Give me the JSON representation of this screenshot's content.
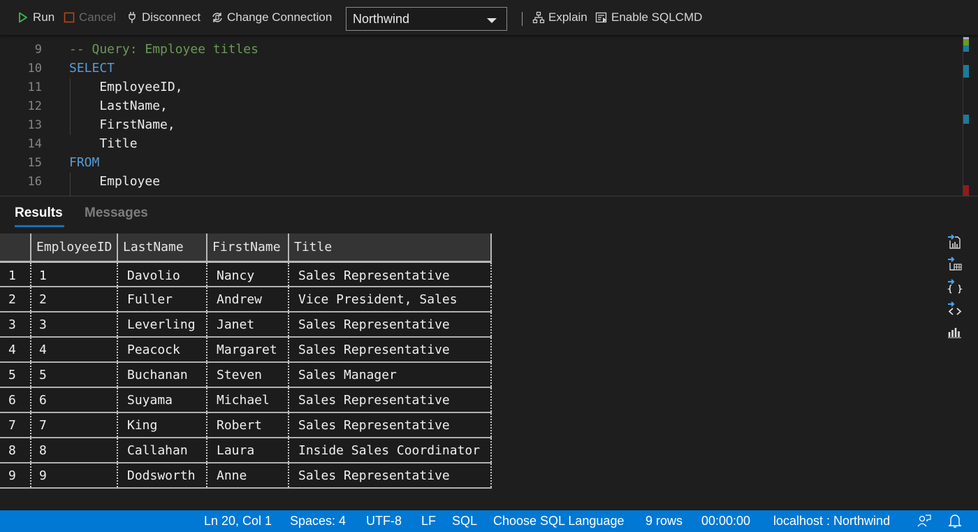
{
  "toolbar": {
    "run_label": "Run",
    "cancel_label": "Cancel",
    "disconnect_label": "Disconnect",
    "change_connection_label": "Change Connection",
    "database_selected": "Northwind",
    "explain_label": "Explain",
    "sqlcmd_label": "Enable SQLCMD",
    "colors": {
      "run_icon": "#3fb950",
      "cancel_icon": "#b5451b"
    }
  },
  "editor": {
    "lines": [
      {
        "num": "9",
        "text": "-- Query: Employee titles",
        "kind": "comment"
      },
      {
        "num": "10",
        "text": "SELECT",
        "kind": "keyword"
      },
      {
        "num": "11",
        "text": "    EmployeeID,",
        "kind": "plain"
      },
      {
        "num": "12",
        "text": "    LastName,",
        "kind": "plain"
      },
      {
        "num": "13",
        "text": "    FirstName,",
        "kind": "plain"
      },
      {
        "num": "14",
        "text": "    Title",
        "kind": "plain"
      },
      {
        "num": "15",
        "text": "FROM",
        "kind": "keyword"
      },
      {
        "num": "16",
        "text": "    Employee",
        "kind": "plain"
      }
    ]
  },
  "results": {
    "tabs": [
      {
        "label": "Results",
        "active": true
      },
      {
        "label": "Messages",
        "active": false
      }
    ],
    "columns": [
      "EmployeeID",
      "LastName",
      "FirstName",
      "Title"
    ],
    "rows": [
      {
        "n": "1",
        "cells": [
          "1",
          "Davolio",
          "Nancy",
          "Sales Representative"
        ]
      },
      {
        "n": "2",
        "cells": [
          "2",
          "Fuller",
          "Andrew",
          "Vice President, Sales"
        ]
      },
      {
        "n": "3",
        "cells": [
          "3",
          "Leverling",
          "Janet",
          "Sales Representative"
        ]
      },
      {
        "n": "4",
        "cells": [
          "4",
          "Peacock",
          "Margaret",
          "Sales Representative"
        ]
      },
      {
        "n": "5",
        "cells": [
          "5",
          "Buchanan",
          "Steven",
          "Sales Manager"
        ]
      },
      {
        "n": "6",
        "cells": [
          "6",
          "Suyama",
          "Michael",
          "Sales Representative"
        ]
      },
      {
        "n": "7",
        "cells": [
          "7",
          "King",
          "Robert",
          "Sales Representative"
        ]
      },
      {
        "n": "8",
        "cells": [
          "8",
          "Callahan",
          "Laura",
          "Inside Sales Coordinator"
        ]
      },
      {
        "n": "9",
        "cells": [
          "9",
          "Dodsworth",
          "Anne",
          "Sales Representative"
        ]
      }
    ],
    "side_actions": [
      "save-as-csv-icon",
      "save-as-excel-icon",
      "save-as-json-icon",
      "save-as-xml-icon",
      "chart-icon"
    ]
  },
  "statusbar": {
    "position": "Ln 20, Col 1",
    "spaces": "Spaces: 4",
    "encoding": "UTF-8",
    "eol": "LF",
    "language": "SQL",
    "choose_language": "Choose SQL Language",
    "row_count": "9 rows",
    "elapsed": "00:00:00",
    "connection": "localhost : Northwind",
    "background": "#0078d4"
  }
}
